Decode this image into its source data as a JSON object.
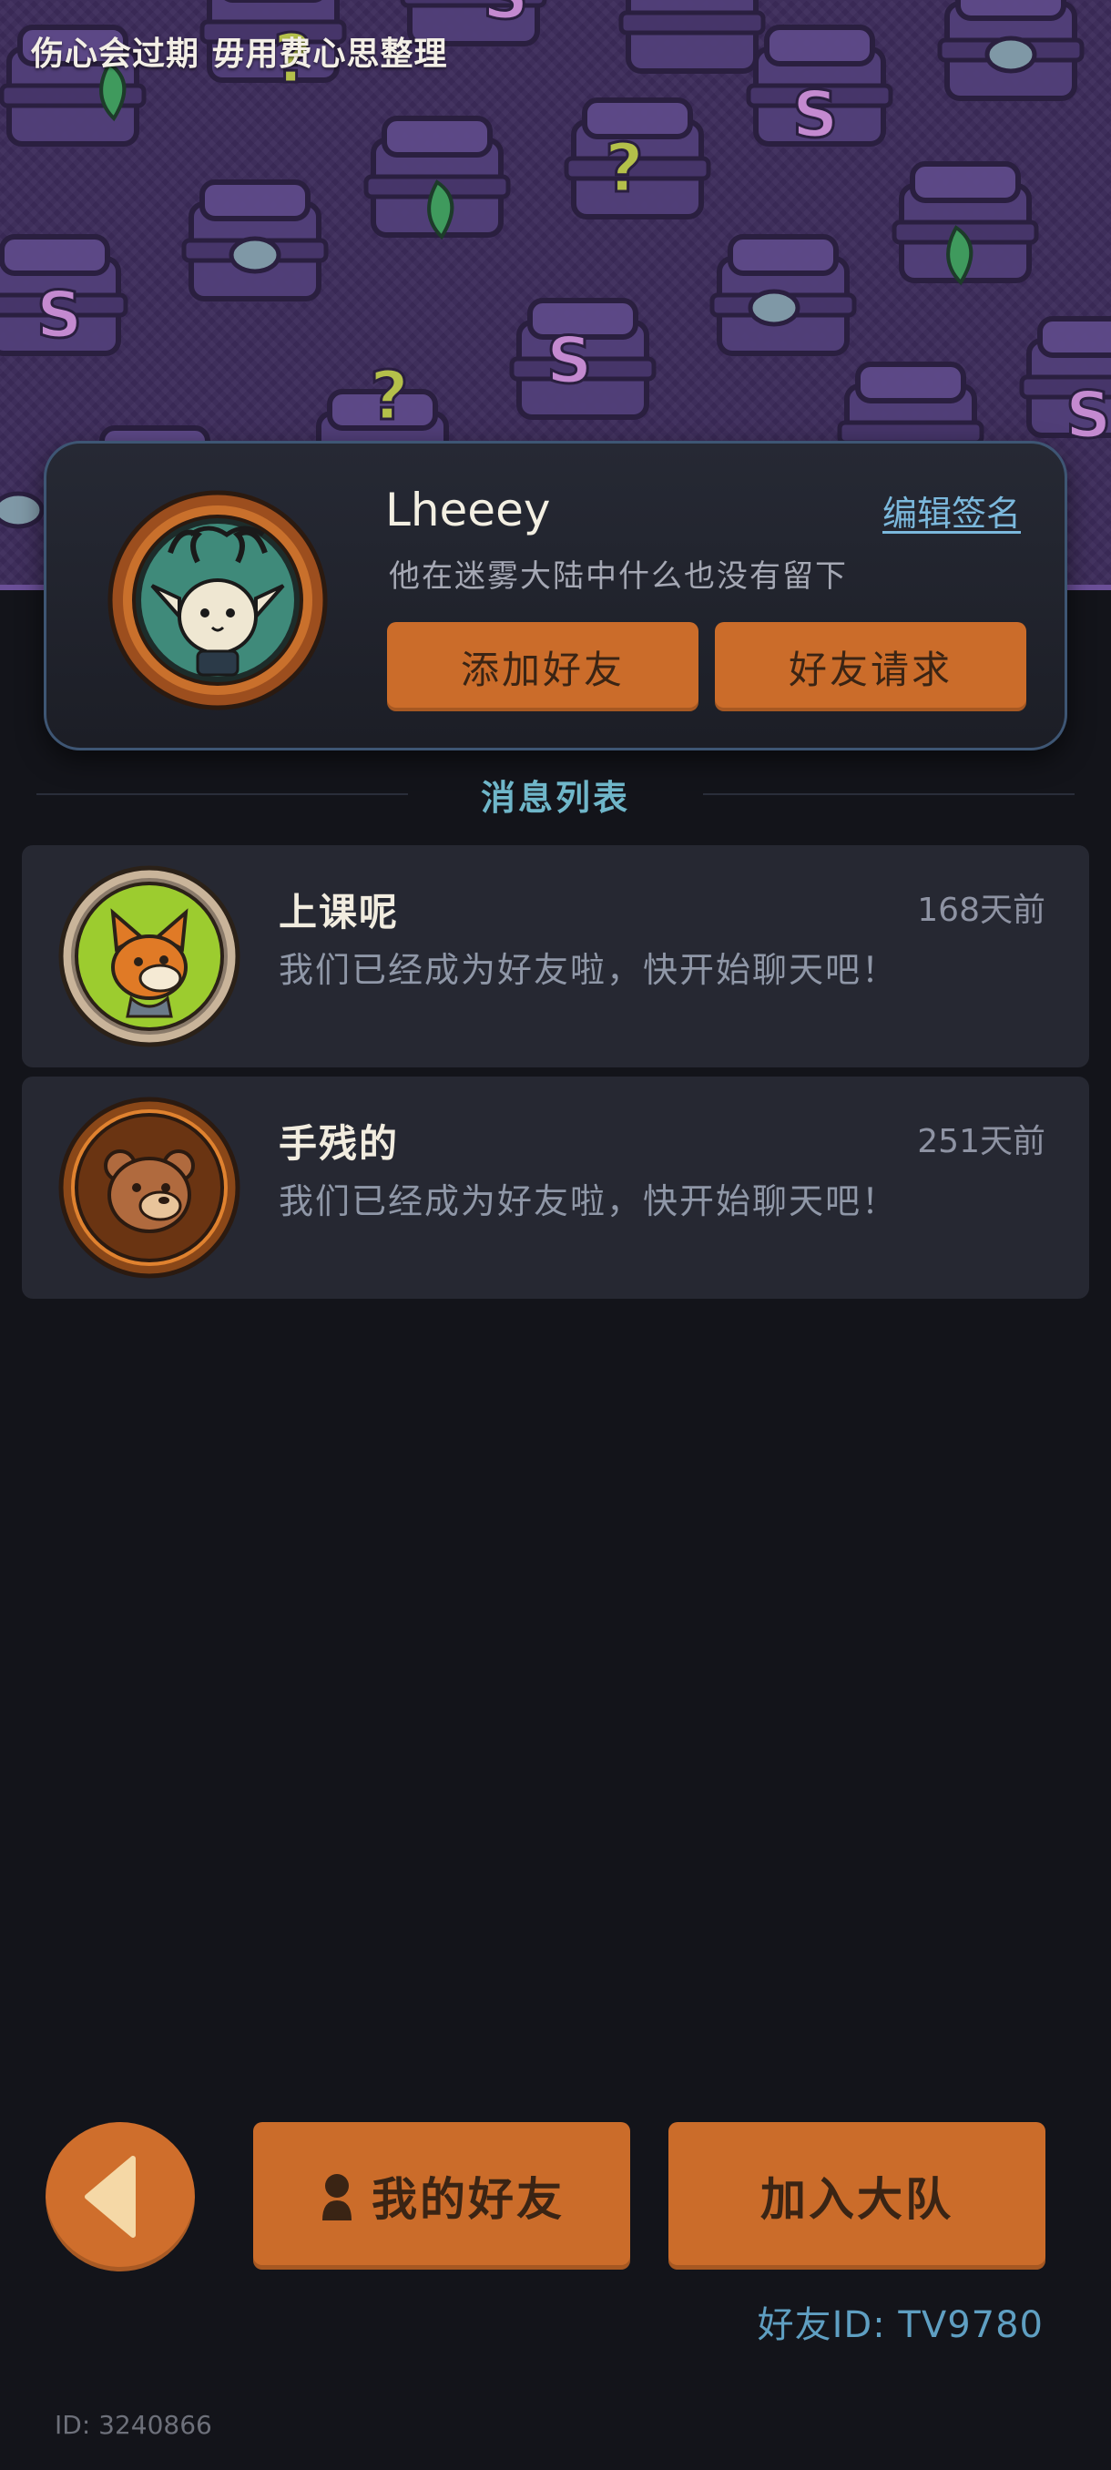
{
  "banner": {
    "motto": "伤心会过期 毋用费心思整理"
  },
  "profile": {
    "name": "Lheeey",
    "edit_sign_label": "编辑签名",
    "signature": "他在迷雾大陆中什么也没有留下",
    "add_friend_label": "添加好友",
    "friend_request_label": "好友请求",
    "avatar_icon": "elk-cat-avatar"
  },
  "message_list": {
    "title": "消息列表",
    "items": [
      {
        "name": "上课呢",
        "time": "168天前",
        "message": "我们已经成为好友啦，快开始聊天吧！",
        "avatar_icon": "fox-avatar"
      },
      {
        "name": "手残的",
        "time": "251天前",
        "message": "我们已经成为好友啦，快开始聊天吧！",
        "avatar_icon": "bear-avatar"
      }
    ]
  },
  "bottom_bar": {
    "back_icon": "back-arrow-icon",
    "my_friends_label": "我的好友",
    "join_team_label": "加入大队",
    "friend_id": "好友ID: TV9780"
  },
  "footer": {
    "user_id": "ID: 3240866"
  },
  "colors": {
    "accent": "#cb6c2a",
    "background": "#13141a",
    "card": "#262832",
    "banner": "#3c2b5a",
    "link": "#7bb8dc"
  }
}
